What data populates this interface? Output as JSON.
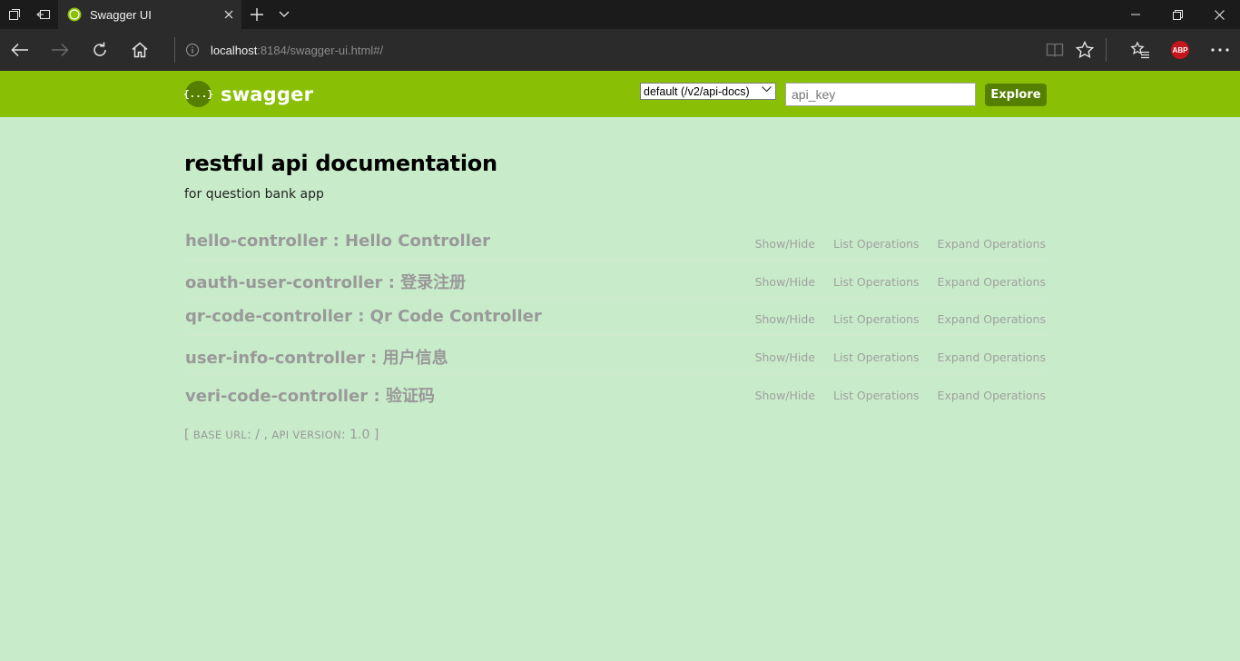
{
  "browser": {
    "tab_title": "Swagger UI",
    "url_host": "localhost",
    "url_rest": ":8184/swagger-ui.html#/",
    "adblock_label": "ABP"
  },
  "swagger": {
    "logo_symbol": "{...}",
    "logo_text": "swagger",
    "spec_selected": "default (/v2/api-docs)",
    "api_key_placeholder": "api_key",
    "explore_label": "Explore"
  },
  "info": {
    "title": "restful api documentation",
    "description": "for question bank app"
  },
  "resources": [
    {
      "name": "hello-controller : Hello Controller",
      "show_hide": "Show/Hide",
      "list_ops": "List Operations",
      "expand_ops": "Expand Operations"
    },
    {
      "name": "oauth-user-controller : 登录注册",
      "show_hide": "Show/Hide",
      "list_ops": "List Operations",
      "expand_ops": "Expand Operations"
    },
    {
      "name": "qr-code-controller : Qr Code Controller",
      "show_hide": "Show/Hide",
      "list_ops": "List Operations",
      "expand_ops": "Expand Operations"
    },
    {
      "name": "user-info-controller : 用户信息",
      "show_hide": "Show/Hide",
      "list_ops": "List Operations",
      "expand_ops": "Expand Operations"
    },
    {
      "name": "veri-code-controller : 验证码",
      "show_hide": "Show/Hide",
      "list_ops": "List Operations",
      "expand_ops": "Expand Operations"
    }
  ],
  "footer": {
    "open_bracket": "[",
    "base_url_label": "BASE URL",
    "base_url_value": ": / , ",
    "api_version_label": "API VERSION",
    "api_version_value": ": 1.0",
    "close_bracket": "]"
  },
  "colors": {
    "header_green": "#89bf04",
    "explore_green": "#547f00",
    "page_background": "#c8ecca",
    "resource_gray": "#999999"
  }
}
